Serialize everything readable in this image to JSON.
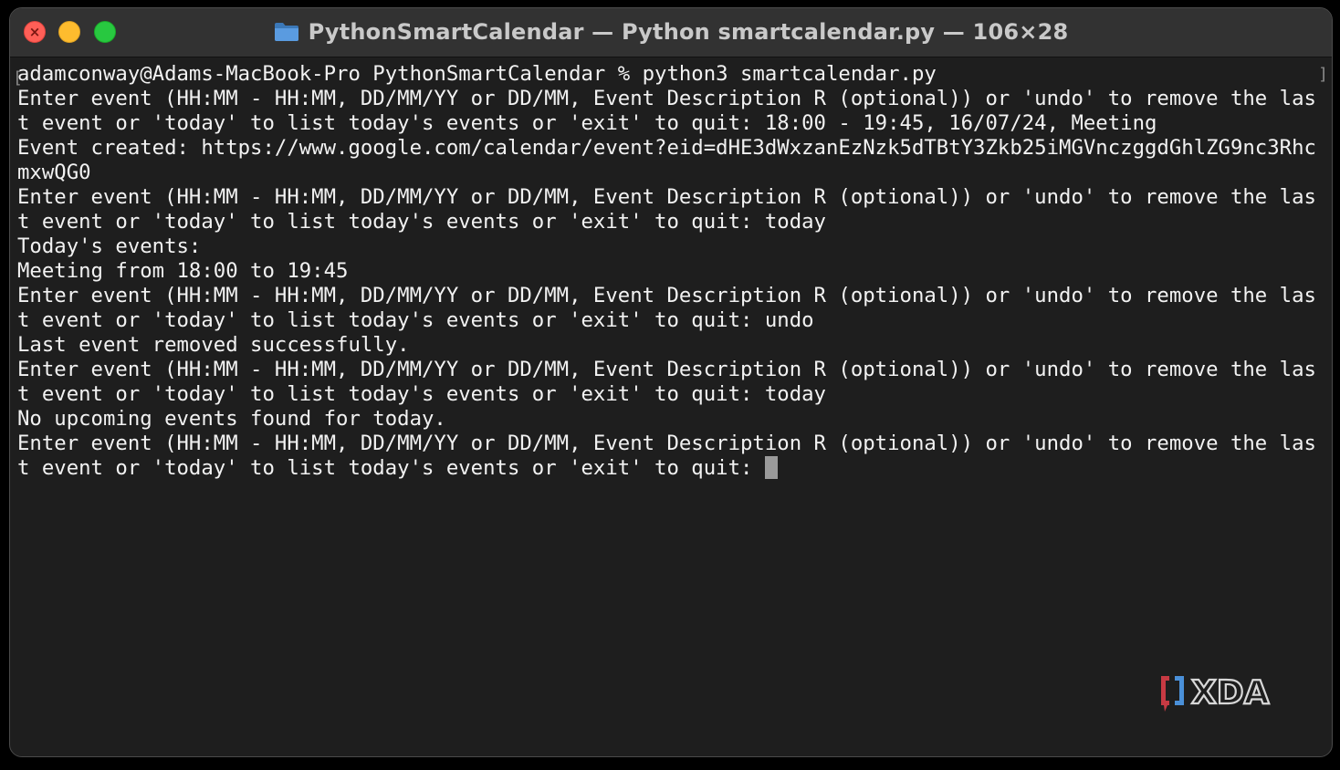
{
  "window": {
    "title": "PythonSmartCalendar — Python smartcalendar.py — 106×28",
    "title_icon": "folder-icon"
  },
  "terminal": {
    "lines": [
      "adamconway@Adams-MacBook-Pro PythonSmartCalendar % python3 smartcalendar.py",
      "Enter event (HH:MM - HH:MM, DD/MM/YY or DD/MM, Event Description R (optional)) or 'undo' to remove the las",
      "t event or 'today' to list today's events or 'exit' to quit: 18:00 - 19:45, 16/07/24, Meeting",
      "Event created: https://www.google.com/calendar/event?eid=dHE3dWxzanEzNzk5dTBtY3Zkb25iMGVnczggdGhlZG9nc3Rhc",
      "mxwQG0",
      "Enter event (HH:MM - HH:MM, DD/MM/YY or DD/MM, Event Description R (optional)) or 'undo' to remove the las",
      "t event or 'today' to list today's events or 'exit' to quit: today",
      "Today's events:",
      "Meeting from 18:00 to 19:45",
      "Enter event (HH:MM - HH:MM, DD/MM/YY or DD/MM, Event Description R (optional)) or 'undo' to remove the las",
      "t event or 'today' to list today's events or 'exit' to quit: undo",
      "Last event removed successfully.",
      "Enter event (HH:MM - HH:MM, DD/MM/YY or DD/MM, Event Description R (optional)) or 'undo' to remove the las",
      "t event or 'today' to list today's events or 'exit' to quit: today",
      "No upcoming events found for today.",
      "Enter event (HH:MM - HH:MM, DD/MM/YY or DD/MM, Event Description R (optional)) or 'undo' to remove the las",
      "t event or 'today' to list today's events or 'exit' to quit: "
    ]
  },
  "watermark": {
    "logo": "xda-logo",
    "text": "XDA"
  },
  "colors": {
    "background": "#1e1e1e",
    "titlebar": "#323232",
    "text": "#f2f2f2",
    "close": "#ff5f57",
    "minimize": "#febc2e",
    "maximize": "#28c840",
    "folder": "#4d8fd1"
  }
}
